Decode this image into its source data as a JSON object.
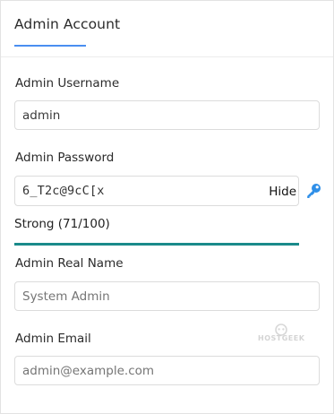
{
  "section": {
    "title": "Admin Account"
  },
  "username": {
    "label": "Admin Username",
    "value": "admin"
  },
  "password": {
    "label": "Admin Password",
    "value": "6_T2c@9cC[x",
    "toggle_label": "Hide",
    "strength_text": "Strong (71/100)",
    "strength_score": 100
  },
  "real_name": {
    "label": "Admin Real Name",
    "placeholder": "System Admin"
  },
  "email": {
    "label": "Admin Email",
    "placeholder": "admin@example.com"
  },
  "watermark": {
    "text": "HOSTGEEK"
  },
  "colors": {
    "accent_underline": "#4a8ef0",
    "strength_fill": "#1a8a8a",
    "key_icon": "#2f8fe8"
  },
  "icons": {
    "generate_password": "key-icon"
  }
}
